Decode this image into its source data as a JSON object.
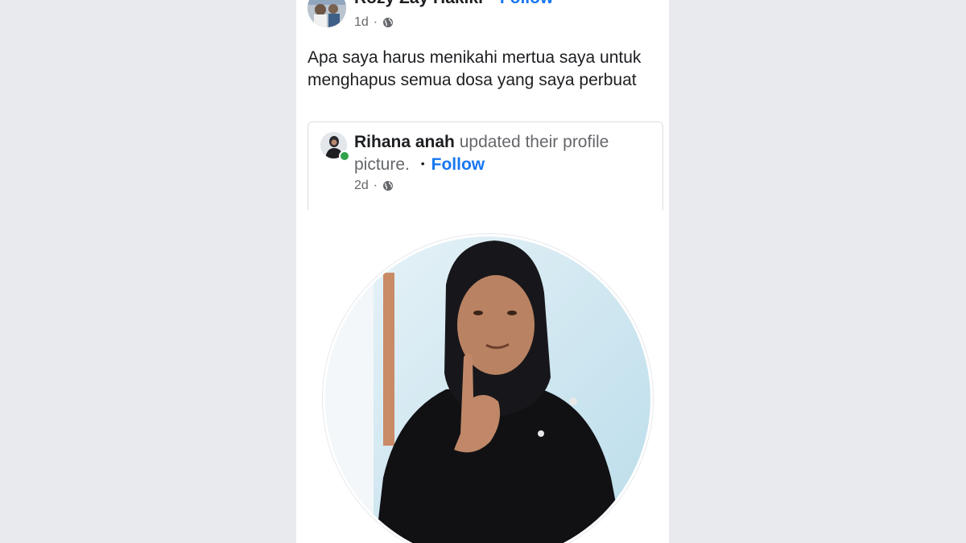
{
  "post": {
    "author": "Rozy Zay Hakiki",
    "separator": "•",
    "follow_label": "Follow",
    "time": "1d",
    "meta_dot": "·",
    "privacy_icon": "globe-icon",
    "text": "Apa saya harus menikahi mertua saya untuk menghapus semua dosa yang saya perbuat"
  },
  "shared": {
    "author": "Rihana anah",
    "action": " updated their profile picture.",
    "separator": "•",
    "follow_label": "Follow",
    "time": "2d",
    "meta_dot": "·",
    "privacy_icon": "globe-icon",
    "online_status_color": "#31a24c"
  },
  "colors": {
    "accent": "#1877f2",
    "background": "#e8eaee",
    "text_primary": "#1c1e21",
    "text_secondary": "#65676b"
  }
}
